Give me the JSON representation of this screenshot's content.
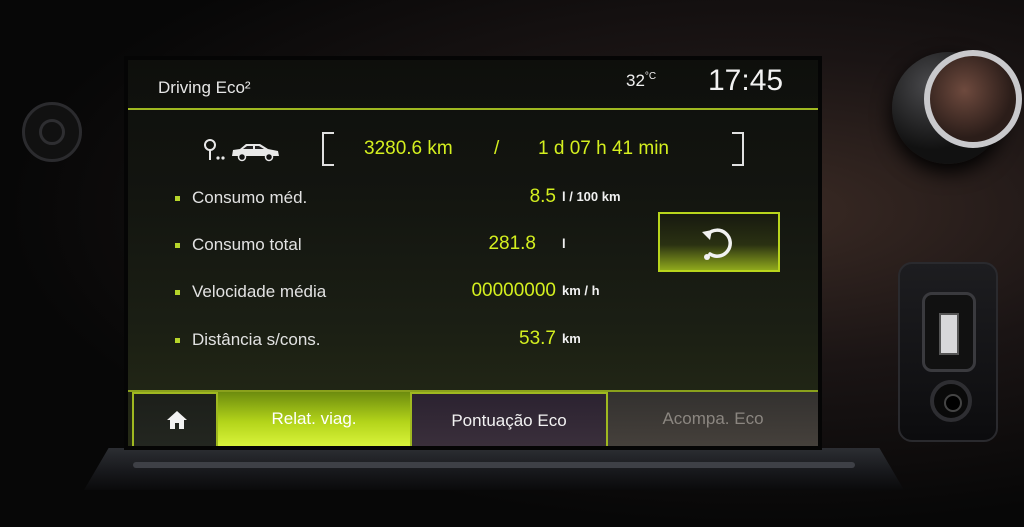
{
  "header": {
    "app_title": "Driving Eco²",
    "temperature": "32",
    "temperature_unit": "°C",
    "clock": "17:45"
  },
  "trip": {
    "distance": "3280.6 km",
    "separator": "/",
    "duration": "1 d 07 h 41 min"
  },
  "metrics": [
    {
      "label": "Consumo méd.",
      "value": "8.5",
      "unit": "l / 100 km"
    },
    {
      "label": "Consumo total",
      "value": "281.8",
      "unit": "l"
    },
    {
      "label": "Velocidade média",
      "value": "00000000",
      "unit": "km / h"
    },
    {
      "label": "Distância s/cons.",
      "value": "53.7",
      "unit": "km"
    }
  ],
  "tabs": {
    "home_icon": "home-icon",
    "trip_report": "Relat. viag.",
    "eco_score": "Pontuação Eco",
    "eco_follow": "Acompa. Eco"
  },
  "icons": {
    "trip_start": "location-pin-icon",
    "vehicle": "car-icon",
    "reset": "reset-icon"
  },
  "colors": {
    "accent": "#d4ef1f",
    "accent_border": "#9fb820",
    "text": "#e6e6e6"
  }
}
